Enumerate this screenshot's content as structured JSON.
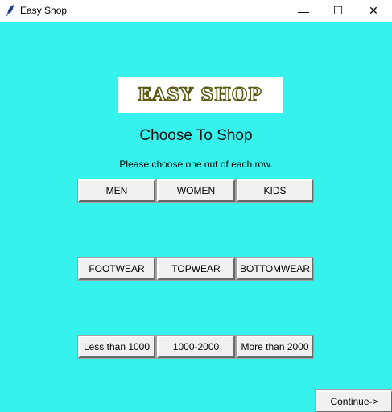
{
  "window": {
    "title": "Easy Shop",
    "minimize": "—",
    "maximize": "☐",
    "close": "✕"
  },
  "logo_text": "EASY SHOP",
  "heading": "Choose To Shop",
  "instruction": "Please choose one out of each row.",
  "rows": [
    [
      "MEN",
      "WOMEN",
      "KIDS"
    ],
    [
      "FOOTWEAR",
      "TOPWEAR",
      "BOTTOMWEAR"
    ],
    [
      "Less than 1000",
      "1000-2000",
      "More than 2000"
    ]
  ],
  "continue_label": "Continue->",
  "colors": {
    "background": "#35f2ec",
    "logo_outline": "#5a5a14"
  }
}
